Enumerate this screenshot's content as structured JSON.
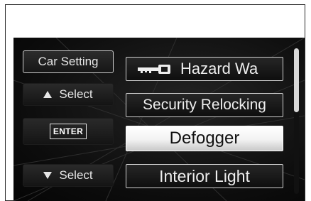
{
  "side_panel": {
    "title": "Car Setting",
    "up_label": "Select",
    "enter_label": "ENTER",
    "down_label": "Select"
  },
  "menu": {
    "items": [
      {
        "label": "Hazard Wa",
        "icon": "key-icon"
      },
      {
        "label": "Security Relocking"
      },
      {
        "label": "Defogger",
        "selected": true
      },
      {
        "label": "Interior Light"
      }
    ]
  },
  "colors": {
    "background": "#0c0c0c",
    "selected_item": "#f2f2f2",
    "text": "#eeeeee"
  }
}
